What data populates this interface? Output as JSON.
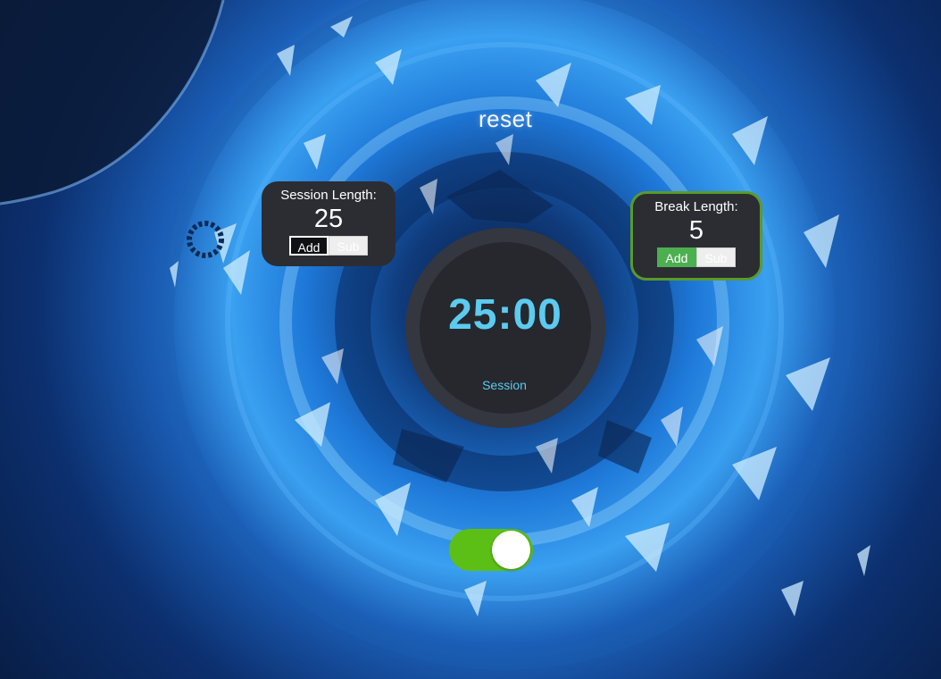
{
  "controls": {
    "reset_label": "reset"
  },
  "session": {
    "title": "Session Length:",
    "value": "25",
    "add_label": "Add",
    "sub_label": "Sub"
  },
  "break": {
    "title": "Break Length:",
    "value": "5",
    "add_label": "Add",
    "sub_label": "Sub"
  },
  "timer": {
    "time": "25:00",
    "label": "Session"
  },
  "toggle": {
    "state": "on"
  },
  "colors": {
    "accent": "#5ccbef",
    "panel": "#2b2d33",
    "toggle_on": "#5cbf16",
    "break_border": "#5a9a2a",
    "break_add": "#4caf50"
  }
}
